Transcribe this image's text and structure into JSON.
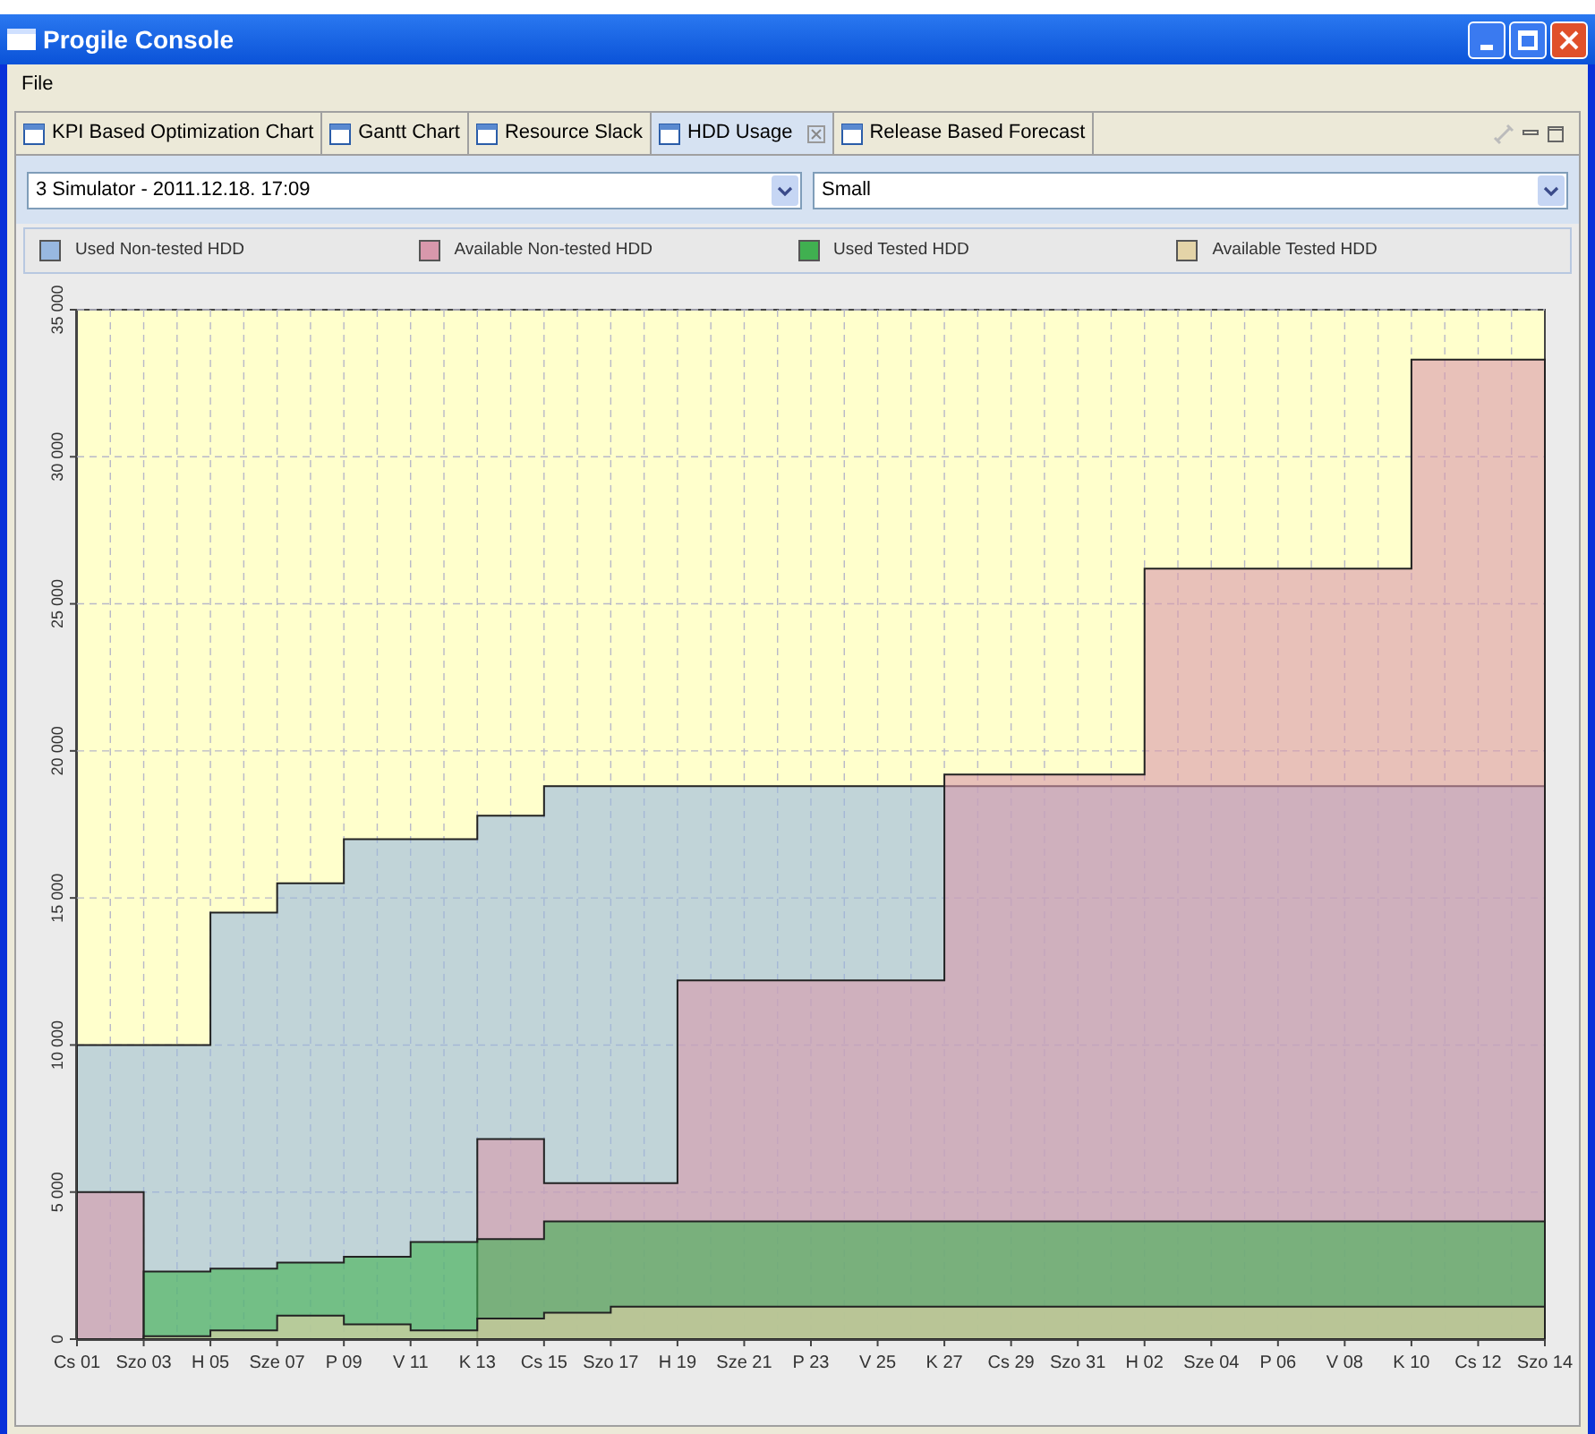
{
  "window": {
    "title": "Progile Console"
  },
  "menu": [
    "File"
  ],
  "tabs": [
    {
      "label": "KPI Based Optimization Chart",
      "selected": false,
      "closable": false
    },
    {
      "label": "Gantt Chart",
      "selected": false,
      "closable": false
    },
    {
      "label": "Resource Slack",
      "selected": false,
      "closable": false
    },
    {
      "label": "HDD Usage",
      "selected": true,
      "closable": true
    },
    {
      "label": "Release Based Forecast",
      "selected": false,
      "closable": false
    }
  ],
  "selectors": [
    {
      "value": "3 Simulator - 2011.12.18. 17:09"
    },
    {
      "value": "Small"
    }
  ],
  "chart_data": {
    "type": "area",
    "stacked": false,
    "grid": true,
    "categories": [
      "Cs 01",
      "Szo 03",
      "H 05",
      "Sze 07",
      "P 09",
      "V 11",
      "K 13",
      "Cs 15",
      "Szo 17",
      "H 19",
      "Sze 21",
      "P 23",
      "V 25",
      "K 27",
      "Cs 29",
      "Szo 31",
      "H 02",
      "Sze 04",
      "P 06",
      "V 08",
      "K 10",
      "Cs 12",
      "Szo 14"
    ],
    "ylim": [
      0,
      35000
    ],
    "yticks": [
      {
        "value": 0,
        "label": "0"
      },
      {
        "value": 5000,
        "label": "5 000"
      },
      {
        "value": 10000,
        "label": "10 000"
      },
      {
        "value": 15000,
        "label": "15 000"
      },
      {
        "value": 20000,
        "label": "20 000"
      },
      {
        "value": 25000,
        "label": "25 000"
      },
      {
        "value": 30000,
        "label": "30 000"
      },
      {
        "value": 35000,
        "label": "35 000"
      }
    ],
    "series": [
      {
        "name": "Used Non-tested HDD",
        "color": "#98b8e0",
        "values": [
          10000,
          10000,
          14500,
          15500,
          17000,
          17000,
          17800,
          18800,
          18800,
          18800,
          18800,
          18800,
          18800,
          18800,
          18800,
          18800,
          18800,
          18800,
          18800,
          18800,
          18800,
          18800,
          18800
        ]
      },
      {
        "name": "Available Non-tested HDD",
        "color": "#d898ac",
        "values": [
          5000,
          0,
          0,
          0,
          0,
          0,
          6800,
          5300,
          5300,
          12200,
          12200,
          12200,
          12200,
          19200,
          19200,
          19200,
          26200,
          26200,
          26200,
          26200,
          33300,
          33300,
          33300
        ]
      },
      {
        "name": "Used Tested HDD",
        "color": "#40b050",
        "values": [
          0,
          2300,
          2400,
          2600,
          2800,
          3300,
          3400,
          4000,
          4000,
          4000,
          4000,
          4000,
          4000,
          4000,
          4000,
          4000,
          4000,
          4000,
          4000,
          4000,
          4000,
          4000,
          4000
        ]
      },
      {
        "name": "Available Tested HDD",
        "color": "#e4d4a8",
        "values": [
          0,
          100,
          300,
          800,
          500,
          300,
          700,
          900,
          1100,
          1100,
          1100,
          1100,
          1100,
          1100,
          1100,
          1100,
          1100,
          1100,
          1100,
          1100,
          1100,
          1100,
          1100
        ]
      }
    ]
  }
}
